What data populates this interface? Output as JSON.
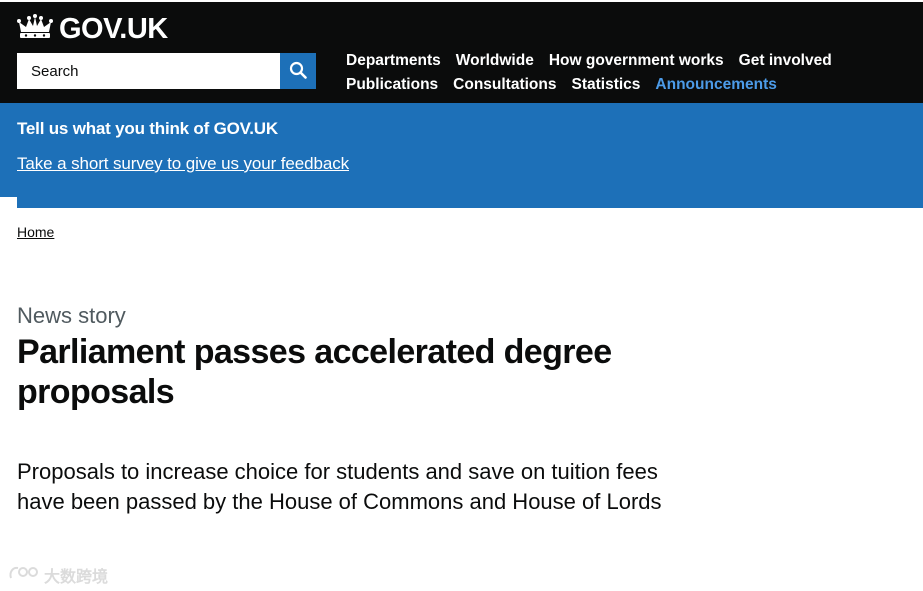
{
  "header": {
    "logo_text": "GOV.UK",
    "logo_icon": "crown-icon",
    "search": {
      "placeholder": "Search",
      "button_icon": "search-icon"
    },
    "nav": {
      "row1": [
        "Departments",
        "Worldwide",
        "How government works",
        "Get involved"
      ],
      "row2": [
        "Publications",
        "Consultations",
        "Statistics",
        "Announcements"
      ],
      "active": "Announcements"
    }
  },
  "banner": {
    "title": "Tell us what you think of GOV.UK",
    "link": "Take a short survey to give us your feedback"
  },
  "breadcrumb": {
    "home": "Home"
  },
  "article": {
    "caption": "News story",
    "title": "Parliament passes accelerated degree proposals",
    "lead": "Proposals to increase choice for students and save on tuition fees have been passed by the House of Commons and House of Lords"
  },
  "watermark": {
    "text": "大数跨境"
  },
  "colors": {
    "header_bg": "#0b0c0c",
    "brand_blue": "#1d70b8",
    "active_link": "#4c9be8",
    "caption_grey": "#505a5f"
  }
}
